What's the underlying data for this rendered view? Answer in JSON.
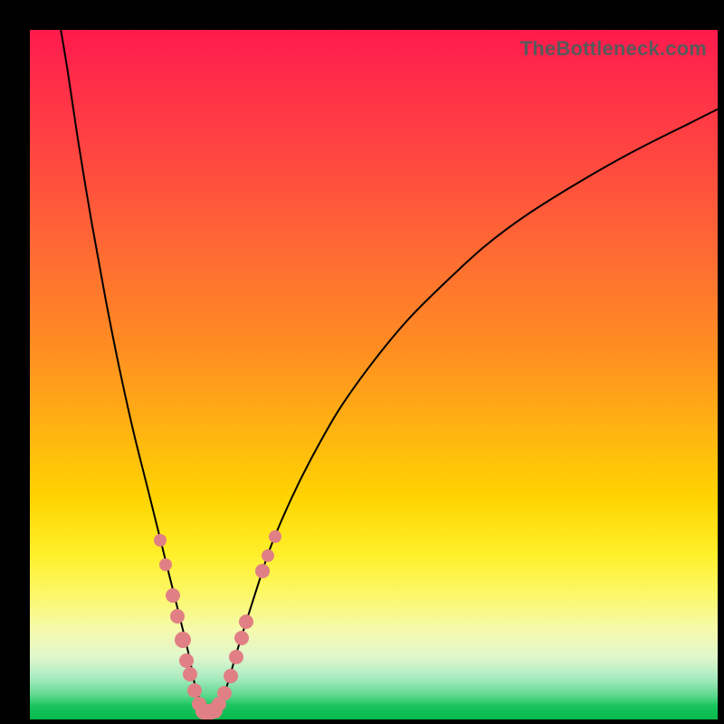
{
  "watermark": "TheBottleneck.com",
  "colors": {
    "dot": "#e18084",
    "curve": "#000000"
  },
  "chart_data": {
    "type": "line",
    "title": "",
    "xlabel": "",
    "ylabel": "",
    "xlim": [
      0,
      100
    ],
    "ylim": [
      0,
      100
    ],
    "grid": false,
    "series": [
      {
        "name": "bottleneck-curve",
        "x": [
          4.5,
          5.5,
          7,
          9,
          11,
          13,
          15,
          17,
          19,
          20.5,
          22,
          23.2,
          24,
          25,
          25.5,
          26.1,
          27,
          28,
          29,
          30,
          31.4,
          33,
          35,
          38,
          41,
          45,
          50,
          55,
          60,
          66,
          72,
          80,
          88,
          96,
          100
        ],
        "y": [
          100,
          94,
          84,
          72,
          61,
          51,
          42,
          34,
          26,
          20,
          14,
          9,
          5,
          2,
          1.2,
          1.0,
          1.5,
          3,
          6,
          9.5,
          14,
          19,
          25,
          32,
          38,
          45,
          52,
          58,
          63,
          68.5,
          73,
          78,
          82.5,
          86.5,
          88.5
        ]
      }
    ],
    "markers": {
      "name": "highlight-dots",
      "style": "circle",
      "color": "#e18084",
      "points": [
        {
          "x": 19.0,
          "y": 26.0,
          "r": 7
        },
        {
          "x": 19.8,
          "y": 22.5,
          "r": 7
        },
        {
          "x": 20.8,
          "y": 18.0,
          "r": 8
        },
        {
          "x": 21.4,
          "y": 15.0,
          "r": 8
        },
        {
          "x": 22.2,
          "y": 11.5,
          "r": 9
        },
        {
          "x": 24.0,
          "y": 4.2,
          "r": 8
        },
        {
          "x": 22.8,
          "y": 8.5,
          "r": 8
        },
        {
          "x": 23.3,
          "y": 6.5,
          "r": 8
        },
        {
          "x": 24.6,
          "y": 2.2,
          "r": 8
        },
        {
          "x": 25.3,
          "y": 1.2,
          "r": 9
        },
        {
          "x": 26.0,
          "y": 1.0,
          "r": 9
        },
        {
          "x": 26.8,
          "y": 1.3,
          "r": 9
        },
        {
          "x": 27.5,
          "y": 2.2,
          "r": 8
        },
        {
          "x": 28.3,
          "y": 3.8,
          "r": 8
        },
        {
          "x": 29.2,
          "y": 6.3,
          "r": 8
        },
        {
          "x": 30.0,
          "y": 9.0,
          "r": 8
        },
        {
          "x": 30.8,
          "y": 11.8,
          "r": 8
        },
        {
          "x": 31.5,
          "y": 14.2,
          "r": 8
        },
        {
          "x": 33.8,
          "y": 21.5,
          "r": 8
        },
        {
          "x": 34.6,
          "y": 23.8,
          "r": 7
        },
        {
          "x": 35.6,
          "y": 26.5,
          "r": 7
        }
      ]
    }
  }
}
